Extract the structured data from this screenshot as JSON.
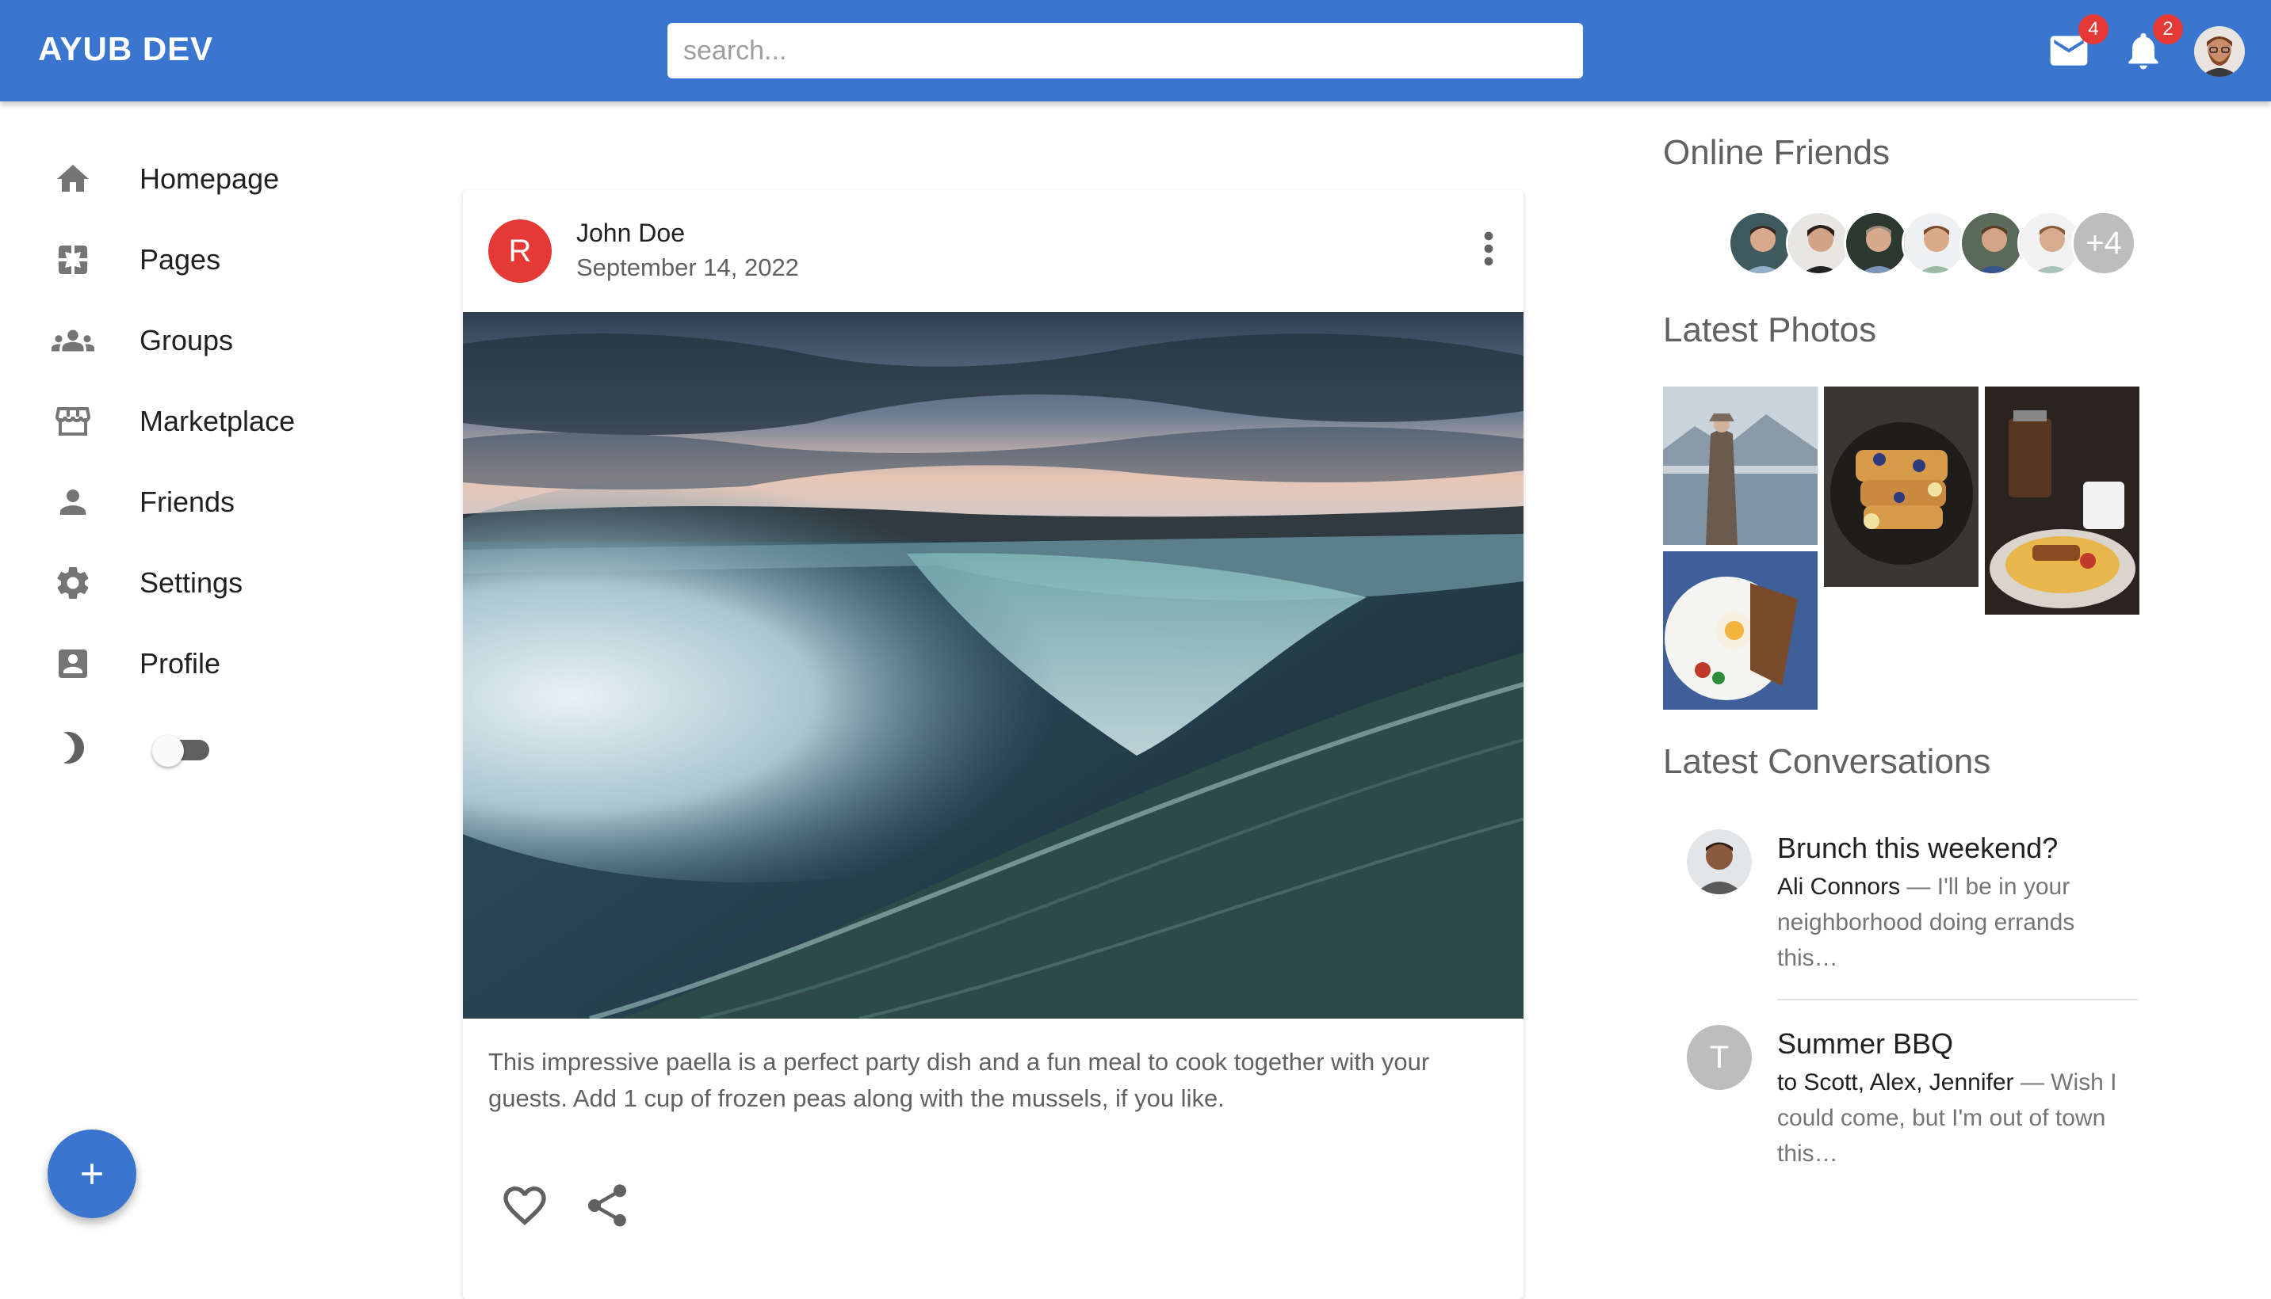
{
  "header": {
    "brand": "AYUB DEV",
    "search_placeholder": "search...",
    "mail_badge": "4",
    "notifications_badge": "2",
    "accent": "#3a76cf"
  },
  "sidebar": {
    "items": [
      {
        "label": "Homepage",
        "icon": "home-icon"
      },
      {
        "label": "Pages",
        "icon": "pages-icon"
      },
      {
        "label": "Groups",
        "icon": "groups-icon"
      },
      {
        "label": "Marketplace",
        "icon": "storefront-icon"
      },
      {
        "label": "Friends",
        "icon": "person-icon"
      },
      {
        "label": "Settings",
        "icon": "gear-icon"
      },
      {
        "label": "Profile",
        "icon": "account-box-icon"
      }
    ],
    "dark_mode_icon": "moon-icon",
    "dark_mode_on": false,
    "fab_icon": "plus-icon"
  },
  "post": {
    "avatar_letter": "R",
    "author": "John Doe",
    "date": "September 14, 2022",
    "image": "waterfall-landscape",
    "text": "This impressive paella is a perfect party dish and a fun meal to cook together with your guests. Add 1 cup of frozen peas along with the mussels, if you like.",
    "actions": [
      "heart-icon",
      "share-icon"
    ]
  },
  "right": {
    "online_title": "Online Friends",
    "online_more": "+4",
    "photos_title": "Latest Photos",
    "conversations_title": "Latest Conversations",
    "conversations": [
      {
        "title": "Brunch this weekend?",
        "who": "Ali Connors",
        "snippet": " — I'll be in your neighborhood doing errands this…",
        "avatar": "photo"
      },
      {
        "title": "Summer BBQ",
        "who": "to Scott, Alex, Jennifer",
        "snippet": " — Wish I could come, but I'm out of town this…",
        "avatar_letter": "T"
      }
    ]
  }
}
